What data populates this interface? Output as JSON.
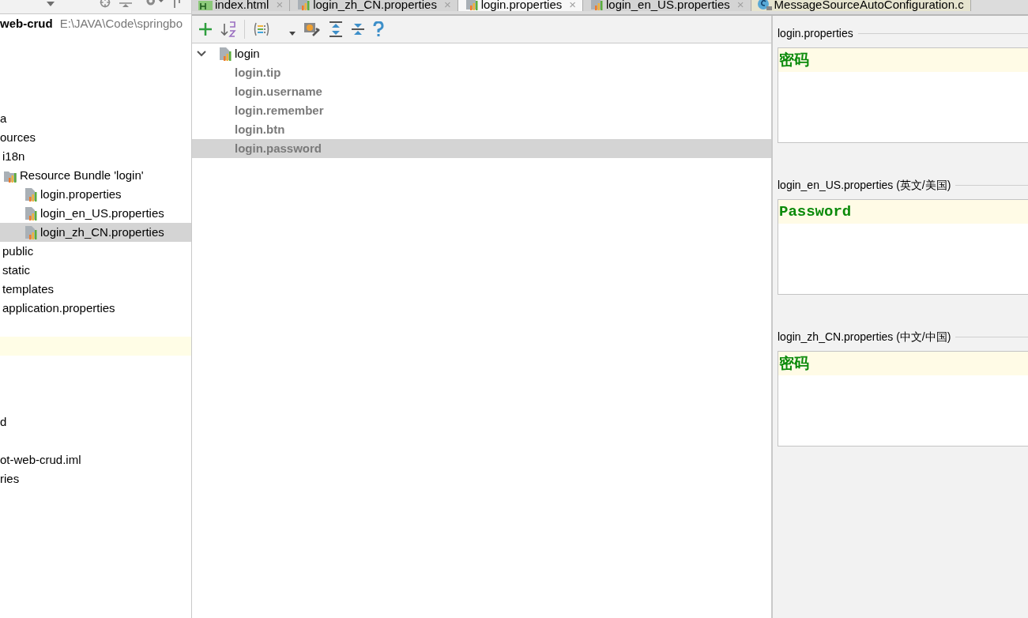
{
  "project_tree": [
    {
      "label": "web-crud",
      "path": "E:\\JAVA\\Code\\springbo",
      "selected": false,
      "children": [
        {
          "label": "a",
          "selected": false
        },
        {
          "label": "ources",
          "selected": false,
          "children": [
            {
              "label": "i18n",
              "selected": false,
              "children": [
                {
                  "label": "Resource Bundle 'login'",
                  "kind": "bundle",
                  "selected": false,
                  "children": [
                    {
                      "label": "login.properties",
                      "kind": "file",
                      "selected": false
                    },
                    {
                      "label": "login_en_US.properties",
                      "kind": "file",
                      "selected": false
                    },
                    {
                      "label": "login_zh_CN.properties",
                      "kind": "file",
                      "selected": true
                    }
                  ]
                }
              ]
            },
            {
              "label": "public",
              "selected": false
            },
            {
              "label": "static",
              "selected": false
            },
            {
              "label": "templates",
              "selected": false
            },
            {
              "label": "application.properties",
              "selected": false
            }
          ]
        },
        {
          "label": "d",
          "selected": false
        },
        {
          "label": "ot-web-crud.iml",
          "selected": false
        },
        {
          "label": "ries",
          "selected": false
        }
      ]
    }
  ],
  "tabs": [
    {
      "label": "index.html",
      "kind": "html",
      "selected": false,
      "closable": true
    },
    {
      "label": "login_zh_CN.properties",
      "kind": "properties",
      "selected": false,
      "closable": true
    },
    {
      "label": "login.properties",
      "kind": "properties",
      "selected": true,
      "closable": true
    },
    {
      "label": "login_en_US.properties",
      "kind": "properties",
      "selected": false,
      "closable": true
    },
    {
      "label": "MessageSourceAutoConfiguration.c",
      "kind": "class",
      "selected": false,
      "closable": false
    }
  ],
  "tab_close": "×",
  "bundle_tree": {
    "label": "login",
    "expanded": true,
    "keys": [
      {
        "label": "login.tip",
        "selected": false
      },
      {
        "label": "login.username",
        "selected": false
      },
      {
        "label": "login.remember",
        "selected": false
      },
      {
        "label": "login.btn",
        "selected": false
      },
      {
        "label": "login.password",
        "selected": true
      }
    ]
  },
  "translations": [
    {
      "file": "login.properties",
      "value": "密码",
      "kind": "cjk"
    },
    {
      "file": "login_en_US.properties (英文/美国)",
      "value": "Password",
      "kind": "latin"
    },
    {
      "file": "login_zh_CN.properties (中文/中国)",
      "value": "密码",
      "kind": "cjk"
    }
  ]
}
